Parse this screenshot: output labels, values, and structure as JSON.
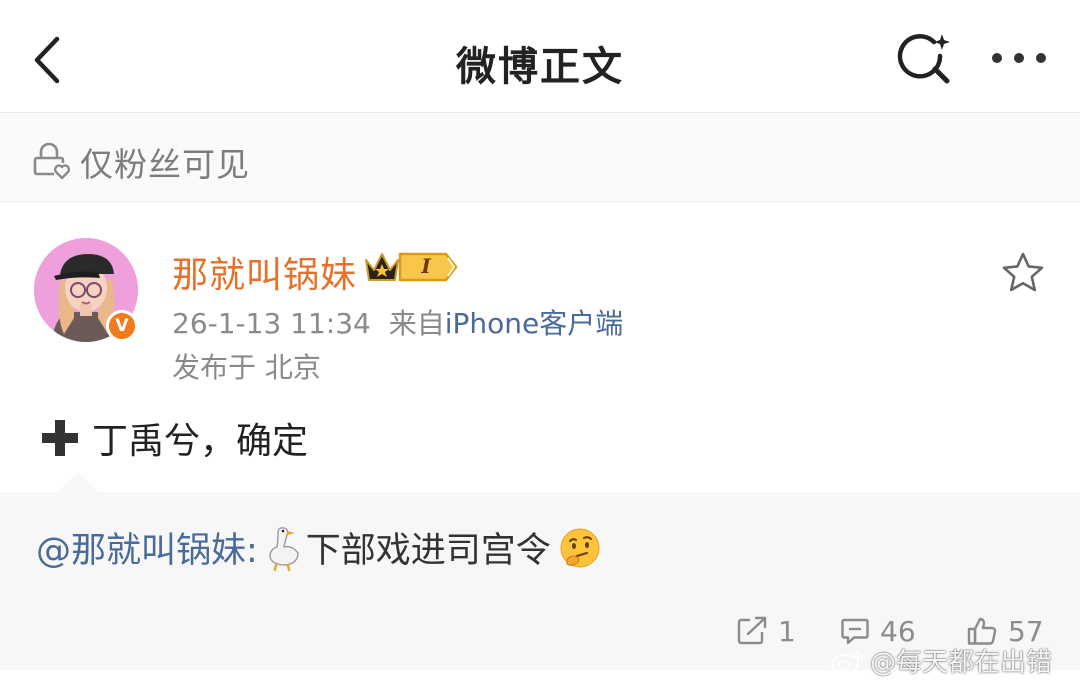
{
  "navbar": {
    "title": "微博正文",
    "back_icon": "chevron-left-icon",
    "search_icon": "search-icon",
    "more_icon": "more-horizontal-icon"
  },
  "visibility": {
    "icon": "lock-heart-icon",
    "label": "仅粉丝可见"
  },
  "post": {
    "author": {
      "name": "那就叫锅妹",
      "verified_badge": "V",
      "level": "I",
      "crown_icon": "crown-icon"
    },
    "timestamp": "26-1-13 11:34",
    "source_prefix": "来自",
    "source": "iPhone客户端",
    "location": "发布于 北京",
    "body": "丁禹兮，确定",
    "body_icon": "plus-icon",
    "favorite_icon": "star-outline-icon"
  },
  "repost": {
    "mention": "@那就叫锅妹:",
    "text": "下部戏进司宫令",
    "emoji_1": "goose-emoji",
    "emoji_2": "thinking-face-emoji"
  },
  "actions": {
    "share_count": "1",
    "comment_count": "46",
    "like_count": "57"
  },
  "watermark": {
    "text": "@每天都在出错"
  },
  "colors": {
    "username": "#e8702a",
    "link": "#4a6a9a",
    "meta": "#8a8a8a",
    "verified": "#f07b1a"
  }
}
